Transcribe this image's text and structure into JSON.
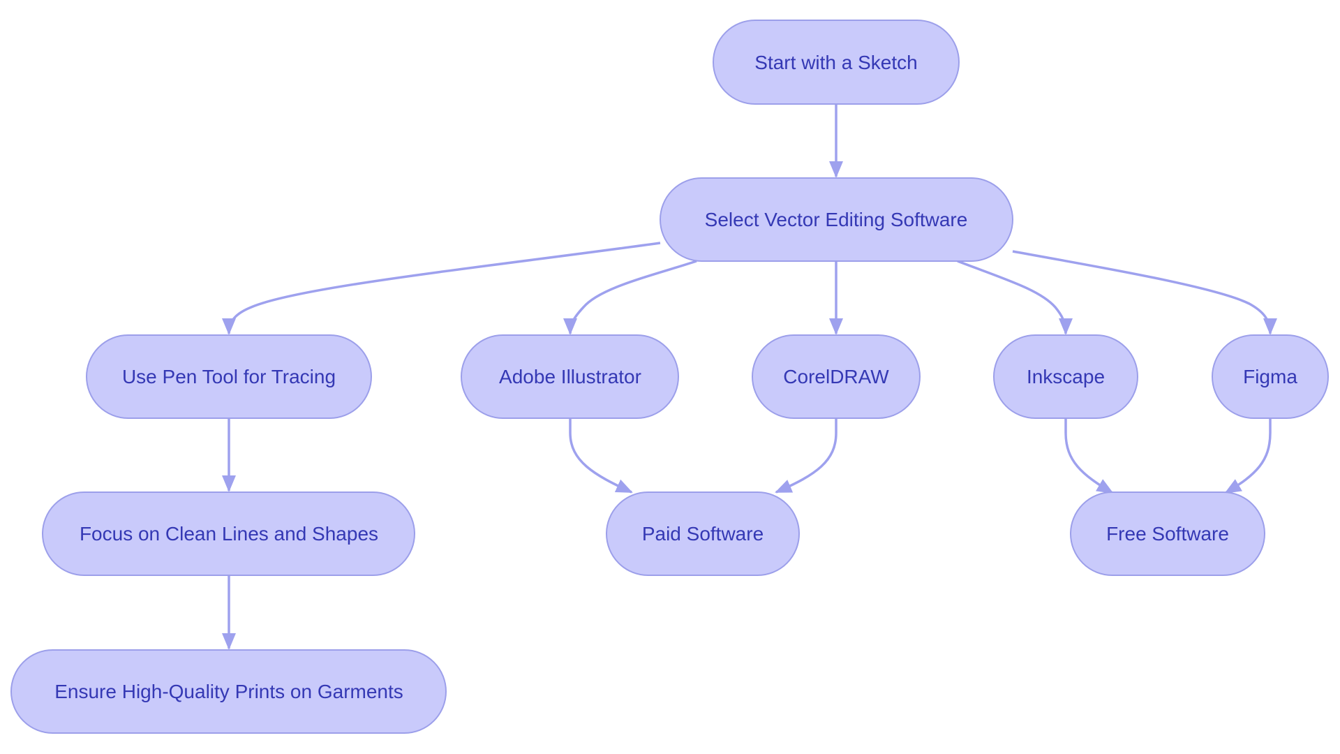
{
  "diagram": {
    "type": "flowchart",
    "direction": "top-down",
    "colors": {
      "node_fill": "#c9cafb",
      "node_stroke": "#9c9fea",
      "node_text": "#3438b4",
      "edge": "#9ea1ee",
      "background": "#ffffff"
    },
    "nodes": [
      {
        "id": "start",
        "label": "Start with a Sketch"
      },
      {
        "id": "select",
        "label": "Select Vector Editing Software"
      },
      {
        "id": "pen",
        "label": "Use Pen Tool for Tracing"
      },
      {
        "id": "adobe",
        "label": "Adobe Illustrator"
      },
      {
        "id": "corel",
        "label": "CorelDRAW"
      },
      {
        "id": "inkscape",
        "label": "Inkscape"
      },
      {
        "id": "figma",
        "label": "Figma"
      },
      {
        "id": "focus",
        "label": "Focus on Clean Lines and Shapes"
      },
      {
        "id": "paid",
        "label": "Paid Software"
      },
      {
        "id": "free",
        "label": "Free Software"
      },
      {
        "id": "ensure",
        "label": "Ensure High-Quality Prints on Garments"
      }
    ],
    "edges": [
      {
        "from": "start",
        "to": "select"
      },
      {
        "from": "select",
        "to": "pen"
      },
      {
        "from": "select",
        "to": "adobe"
      },
      {
        "from": "select",
        "to": "corel"
      },
      {
        "from": "select",
        "to": "inkscape"
      },
      {
        "from": "select",
        "to": "figma"
      },
      {
        "from": "pen",
        "to": "focus"
      },
      {
        "from": "adobe",
        "to": "paid"
      },
      {
        "from": "corel",
        "to": "paid"
      },
      {
        "from": "inkscape",
        "to": "free"
      },
      {
        "from": "figma",
        "to": "free"
      },
      {
        "from": "focus",
        "to": "ensure"
      }
    ]
  }
}
